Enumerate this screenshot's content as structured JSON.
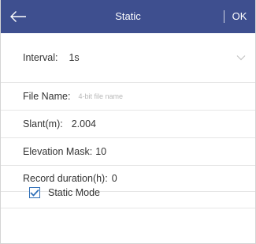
{
  "header": {
    "title": "Static",
    "ok_label": "OK",
    "back_icon": "arrow-left-icon"
  },
  "colors": {
    "header_bg": "#3e4f8f",
    "header_text": "#ffffff",
    "checkbox_accent": "#2f6fb8"
  },
  "form": {
    "interval": {
      "label": "Interval:",
      "value": "1s",
      "icon": "chevron-down-icon"
    },
    "file_name": {
      "label": "File Name:",
      "placeholder": "4-bit file name",
      "value": ""
    },
    "slant": {
      "label": "Slant(m):",
      "value": "2.004"
    },
    "elevation_mask": {
      "label": "Elevation Mask:",
      "value": "10"
    },
    "record_duration": {
      "label": "Record duration(h):",
      "value": "0"
    },
    "static_mode": {
      "label": "Static Mode",
      "checked": true
    }
  }
}
